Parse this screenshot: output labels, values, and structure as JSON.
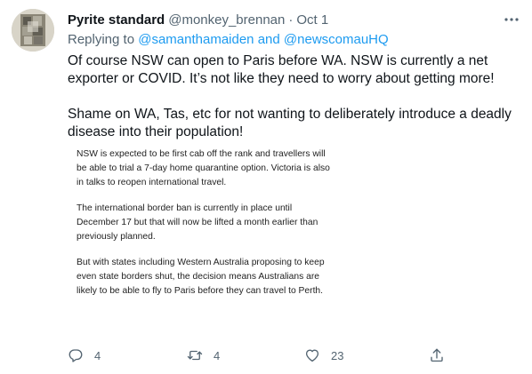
{
  "tweet": {
    "author": {
      "display_name": "Pyrite standard",
      "handle": "@monkey_brennan",
      "avatar_icon": "avatar-photo"
    },
    "separator": "·",
    "date": "Oct 1",
    "more_icon": "more-horizontal-icon",
    "replying_to": {
      "prefix": "Replying to ",
      "mention_1": "@samanthamaiden",
      "conjunction": " and ",
      "mention_2": "@newscomauHQ"
    },
    "text_paragraphs": [
      "Of course NSW can open to Paris before WA. NSW is currently a net exporter or COVID. It’s not like they need to worry about getting more!",
      "Shame on WA, Tas, etc for not wanting to deliberately introduce a deadly disease into their population!"
    ],
    "attachment_paragraphs": [
      "NSW is expected to be first cab off the rank and travellers will be able to trial a 7-day home quarantine option. Victoria is also in talks to reopen international travel.",
      "The international border ban is currently in place until December 17 but that will now be lifted a month earlier than previously planned.",
      "But with states including Western Australia proposing to keep even state borders shut, the decision means Australians are likely to be able to fly to Paris before they can travel to Perth."
    ],
    "actions": {
      "reply_count": "4",
      "retweet_count": "4",
      "like_count": "23"
    }
  },
  "colors": {
    "text_primary": "#0f1419",
    "text_secondary": "#536471",
    "link": "#1d9bf0",
    "background": "#ffffff"
  }
}
